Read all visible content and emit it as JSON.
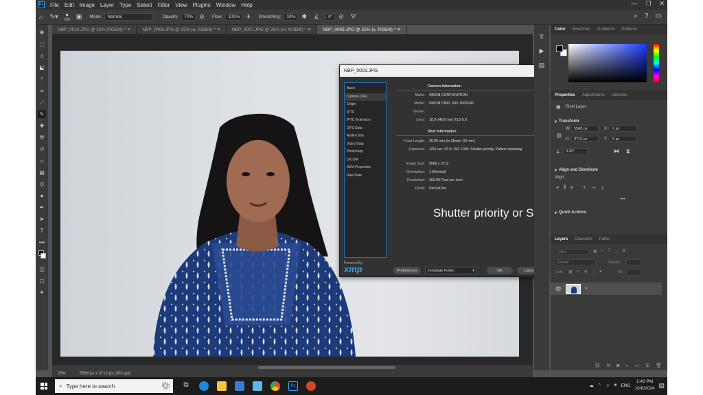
{
  "app": {
    "logo": "Ps"
  },
  "menu": [
    "File",
    "Edit",
    "Image",
    "Layer",
    "Type",
    "Select",
    "Filter",
    "View",
    "Plugins",
    "Window",
    "Help"
  ],
  "options": {
    "brush_size": "250",
    "mode_label": "Mode:",
    "mode": "Normal",
    "opacity_label": "Opacity:",
    "opacity": "70%",
    "flow_label": "Flow:",
    "flow": "100%",
    "smoothing_label": "Smoothing:",
    "smoothing": "10%",
    "angle": "0°"
  },
  "tabs": [
    {
      "label": "NBP_0010.JPG @ 25% (RGB/8) *"
    },
    {
      "label": "NBP_0008.JPG @ 25% (a, RGB/8) *"
    },
    {
      "label": "NBP_0007.JPG @ 25% (m, RGB/8) *"
    },
    {
      "label": "NBP_0003.JPG @ 25% (s, RGB/8) *"
    }
  ],
  "status": {
    "zoom": "25%",
    "doc": "5568 px x 3712 px (300 ppi)"
  },
  "dialog": {
    "title": "NBP_0003.JPG",
    "sidebar": [
      "Basic",
      "Camera Data",
      "Origin",
      "IPTC",
      "IPTC Extension",
      "GPS Data",
      "Audio Data",
      "Video Data",
      "Photoshop",
      "DICOM",
      "AEM Properties",
      "Raw Data"
    ],
    "camera_header": "Camera Information",
    "make_label": "Make:",
    "make": "NIKON CORPORATION",
    "model_label": "Model:",
    "model": "NIKON D500,   S/N: 8001546",
    "owner_label": "Owner:",
    "lens_label": "Lens:",
    "lens": "18.0-140.0 mm f/3.5-5.6",
    "shot_header": "Shot Information",
    "focal_label": "Focal Length:",
    "focal": "26.00 mm   (in 35mm: 39 mm)",
    "exposure_label": "Exposure:",
    "exposure": "1/60 sec;  f/3.8;  ISO 1000;   Shutter priority;   Pattern metering",
    "size_label": "Image Size:",
    "size": "5568 x 3712",
    "orient_label": "Orientation:",
    "orient": "1 (Normal)",
    "res_label": "Resolution:",
    "res": "300.00 Pixel per Inch",
    "flash_label": "Flash:",
    "flash": "Did not fire",
    "overlay_text": "Shutter priority or S",
    "powered_by": "Powered By",
    "xmp": "xmp",
    "preferences": "Preferences",
    "template": "Template Folder",
    "ok": "OK",
    "cancel": "Cancel"
  },
  "color_panel": {
    "tabs": [
      "Color",
      "Swatches",
      "Gradients",
      "Patterns"
    ]
  },
  "properties": {
    "tabs": [
      "Properties",
      "Adjustments",
      "Libraries"
    ],
    "layer_type": "Pixel Layer",
    "transform": "Transform",
    "w_label": "W",
    "w": "5568 px",
    "h_label": "H",
    "h": "3712 px",
    "x_label": "X",
    "x": "0 px",
    "y_label": "Y",
    "y": "0 px",
    "angle": "0.00°",
    "align": "Align and Distribute",
    "align_label": "Align:",
    "more": "•••",
    "quick": "Quick Actions"
  },
  "layers": {
    "tabs": [
      "Layers",
      "Channels",
      "Paths"
    ],
    "kind": "Kind",
    "blend": "Normal",
    "opacity_label": "Opacity:",
    "lock_label": "Lock:",
    "fill_label": "Fill:",
    "layer_name": "s"
  },
  "taskbar": {
    "search": "Type here to search",
    "lang": "ENG",
    "time": "1:43 PM",
    "date": "10/6/2024"
  }
}
